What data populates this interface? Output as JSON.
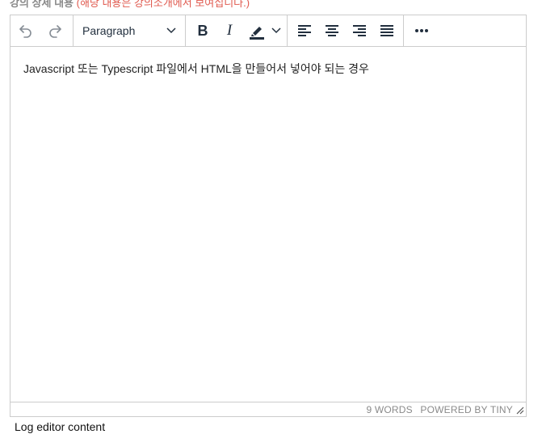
{
  "field": {
    "label": "강의 상세 내용",
    "note": "(해당 내용은 강의소개에서 보여집니다.)"
  },
  "toolbar": {
    "undo_icon": "undo-icon",
    "redo_icon": "redo-icon",
    "block_format": "Paragraph",
    "bold_icon": "bold-icon",
    "italic_icon": "italic-icon",
    "highlight_icon": "highlight-color-icon",
    "align_left_icon": "align-left-icon",
    "align_center_icon": "align-center-icon",
    "align_right_icon": "align-right-icon",
    "justify_icon": "align-justify-icon",
    "more_icon": "more-icon",
    "icon_color": "#222f3e",
    "highlight_color": "#222f3e"
  },
  "content": {
    "text": "Javascript 또는 Typescript 파일에서 HTML을 만들어서 넣어야 되는 경우"
  },
  "statusbar": {
    "word_count": "9 WORDS",
    "branding": "POWERED BY TINY"
  },
  "footer": {
    "log_button": "Log editor content"
  }
}
